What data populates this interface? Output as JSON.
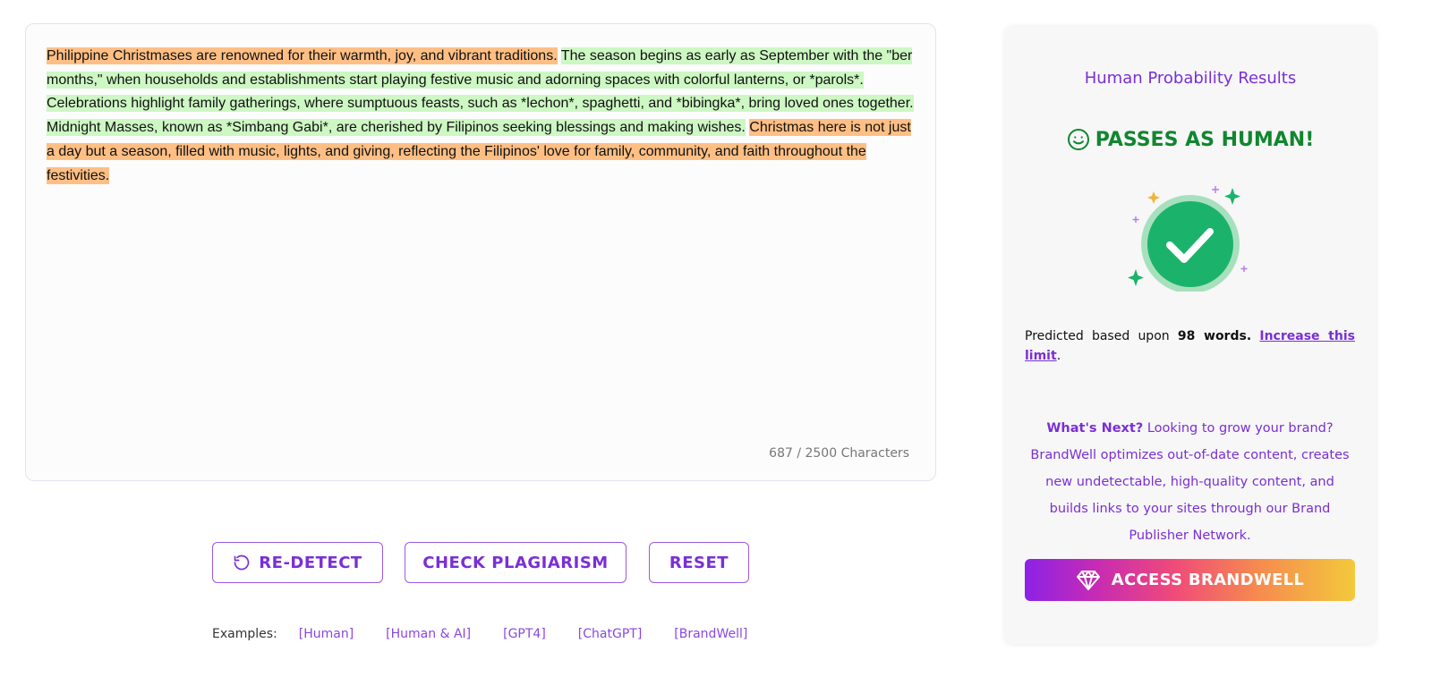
{
  "editor": {
    "segments": [
      {
        "text": "Philippine Christmases are renowned for their warmth, joy, and vibrant traditions.",
        "highlight": "orange"
      },
      {
        "text": " ",
        "highlight": "none"
      },
      {
        "text": "The season begins as early as September with the \"ber months,\" when households and establishments start playing festive music and adorning spaces with colorful lanterns, or *parols*.",
        "highlight": "green"
      },
      {
        "text": " ",
        "highlight": "none"
      },
      {
        "text": "Celebrations highlight family gatherings, where sumptuous feasts, such as *lechon*, spaghetti, and *bibingka*, bring loved ones together.",
        "highlight": "green"
      },
      {
        "text": " ",
        "highlight": "none"
      },
      {
        "text": "Midnight Masses, known as *Simbang Gabi*, are cherished by Filipinos seeking blessings and making wishes.",
        "highlight": "green"
      },
      {
        "text": " ",
        "highlight": "none"
      },
      {
        "text": "Christmas here is not just a day but a season, filled with music, lights, and giving, reflecting the Filipinos' love for family, community, and faith throughout the festivities.",
        "highlight": "orange"
      }
    ],
    "char_count": "687 / 2500 Characters"
  },
  "actions": {
    "redetect": "RE-DETECT",
    "plagiarism": "CHECK PLAGIARISM",
    "reset": "RESET"
  },
  "examples": {
    "label": "Examples:",
    "items": [
      "[Human]",
      "[Human & AI]",
      "[GPT4]",
      "[ChatGPT]",
      "[BrandWell]"
    ]
  },
  "results": {
    "title": "Human Probability Results",
    "verdict": "PASSES AS HUMAN!",
    "predicted_prefix": "Predicted based upon",
    "word_count": "98 words.",
    "increase_link": "Increase this limit",
    "predicted_suffix": ".",
    "whats_next_label": "What's Next?",
    "whats_next_text": "Looking to grow your brand? BrandWell optimizes out-of-date content, creates new undetectable, high-quality content, and builds links to your sites through our Brand Publisher Network.",
    "access_button": "ACCESS BRANDWELL"
  },
  "colors": {
    "accent": "#7a2fd6",
    "pass_green": "#11862f",
    "highlight_orange": "#ffbf84",
    "highlight_green": "#cdf7c3"
  },
  "icons": {
    "redetect": "refresh-icon",
    "verdict": "smile-icon",
    "badge": "check-circle-icon",
    "access": "diamond-icon"
  }
}
